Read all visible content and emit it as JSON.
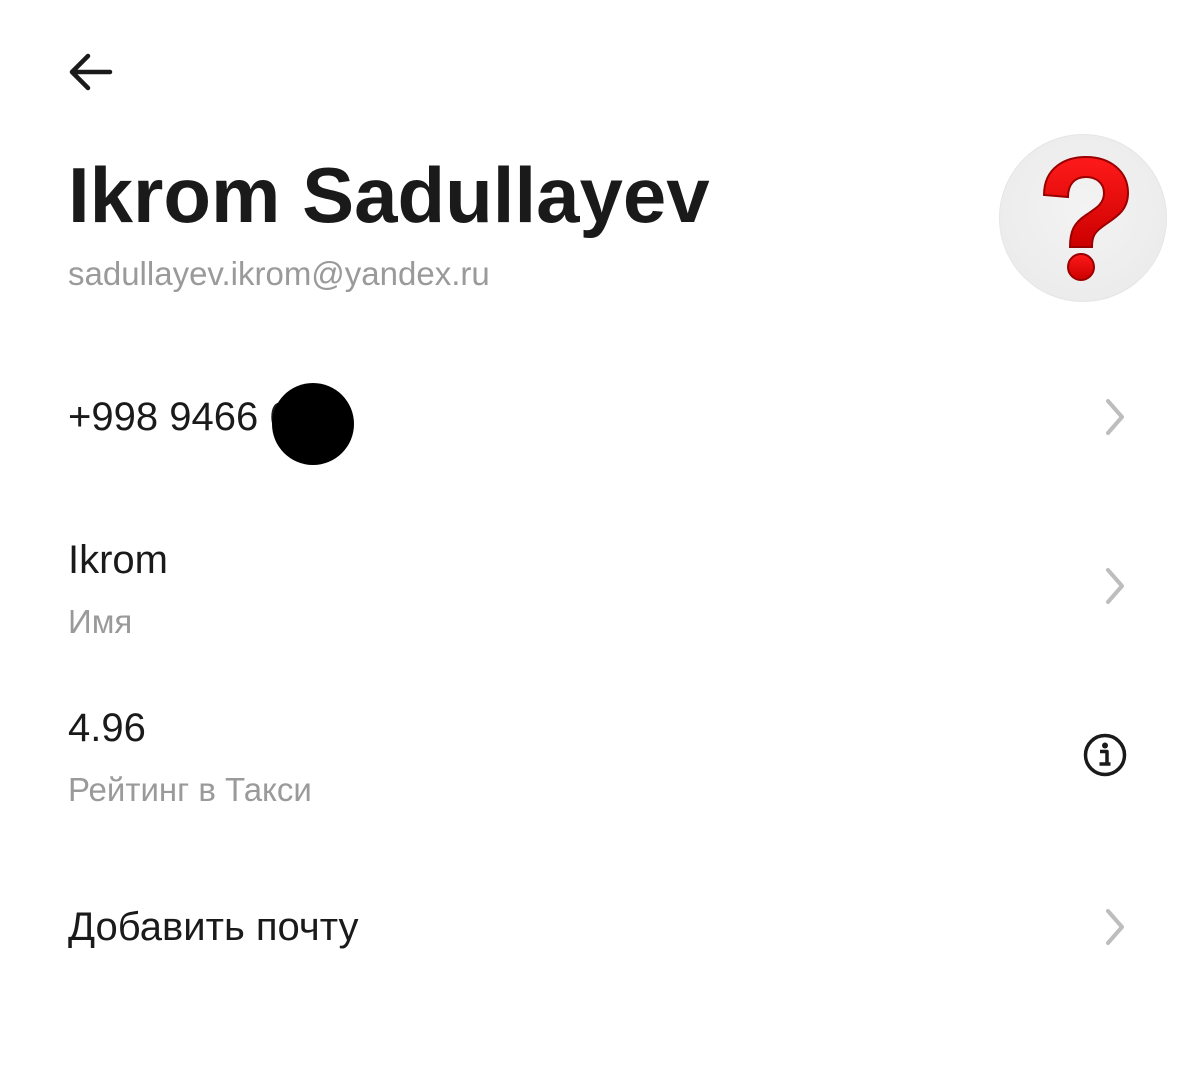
{
  "icons": {
    "back": "arrow-left-icon",
    "chevron": "chevron-right-icon",
    "info": "info-icon",
    "avatar": "question-mark-icon"
  },
  "colors": {
    "accent": "#e30613",
    "primary_text": "#1a1a1a",
    "secondary_text": "#9a9a9a",
    "chevron": "#bdbdbd"
  },
  "profile": {
    "name": "Ikrom Sadullayev",
    "email": "sadullayev.ikrom@yandex.ru"
  },
  "rows": {
    "phone": {
      "value": "+998 9466     66"
    },
    "name": {
      "value": "Ikrom",
      "label": "Имя"
    },
    "rating": {
      "value": "4.96",
      "label": "Рейтинг в Такси"
    },
    "add_email": {
      "label": "Добавить почту"
    }
  }
}
